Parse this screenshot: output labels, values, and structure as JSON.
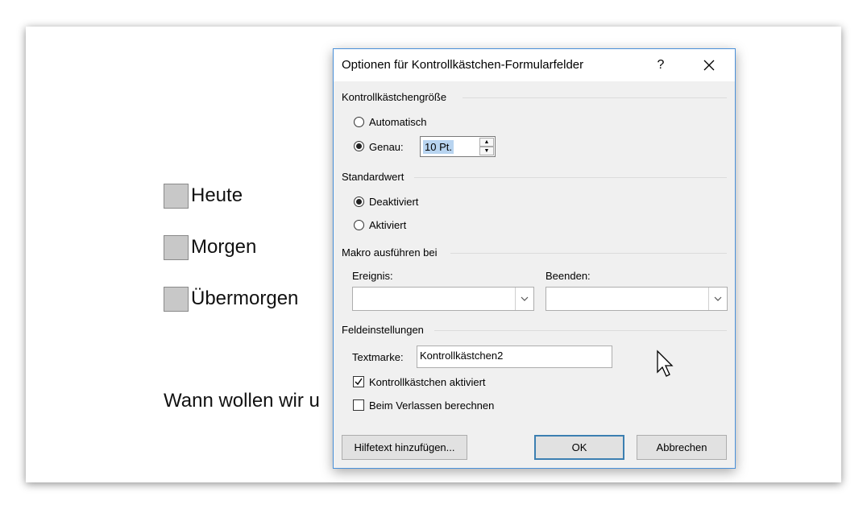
{
  "document": {
    "checkboxes": [
      {
        "label": "Heute"
      },
      {
        "label": "Morgen"
      },
      {
        "label": "Übermorgen"
      }
    ],
    "question_text": "Wann wollen wir u"
  },
  "dialog": {
    "title": "Optionen für Kontrollkästchen-Formularfelder",
    "help_label": "?",
    "close_label": "✕",
    "size_group": {
      "title": "Kontrollkästchengröße",
      "automatic_label": "Automatisch",
      "exact_label": "Genau:",
      "exact_value": "10 Pt.",
      "selected": "exact"
    },
    "default_group": {
      "title": "Standardwert",
      "disabled_label": "Deaktiviert",
      "enabled_label": "Aktiviert",
      "selected": "disabled"
    },
    "macro_group": {
      "title": "Makro ausführen bei",
      "entry_label": "Ereignis:",
      "entry_value": "",
      "exit_label": "Beenden:",
      "exit_value": ""
    },
    "field_group": {
      "title": "Feldeinstellungen",
      "bookmark_label": "Textmarke:",
      "bookmark_value": "Kontrollkästchen2",
      "enabled_label": "Kontrollkästchen aktiviert",
      "enabled_checked": true,
      "calc_label": "Beim Verlassen berechnen",
      "calc_checked": false
    },
    "buttons": {
      "help_text": "Hilfetext hinzufügen...",
      "ok": "OK",
      "cancel": "Abbrechen"
    }
  }
}
